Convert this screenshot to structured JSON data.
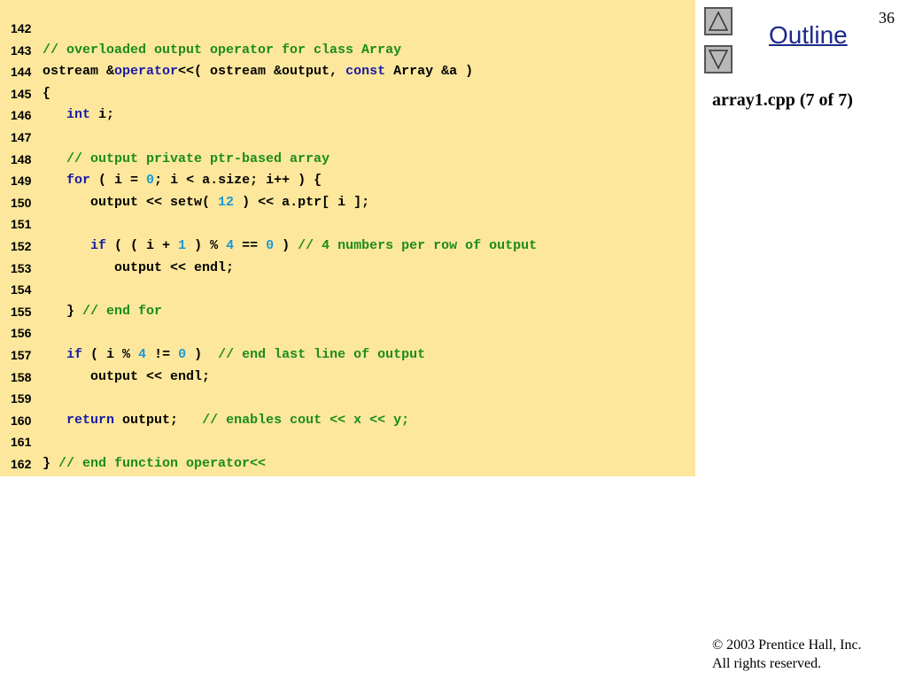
{
  "header": {
    "page_number": "36",
    "outline_label": "Outline",
    "slide_subtitle": "array1.cpp (7 of 7)"
  },
  "footer": {
    "copyright_line1": "© 2003 Prentice Hall, Inc.",
    "copyright_line2": "All rights reserved."
  },
  "nav": {
    "up_icon": "triangle-up-icon",
    "down_icon": "triangle-down-icon"
  },
  "colors": {
    "code_background": "#fce79c",
    "comment": "#1a8c1a",
    "keyword": "#1a1aa6",
    "number": "#1a9ad6",
    "outline_link": "#1b2a8a"
  },
  "code": {
    "lines": [
      {
        "num": "142",
        "tokens": []
      },
      {
        "num": "143",
        "tokens": [
          {
            "t": "cm",
            "v": "// overloaded output operator for class Array"
          }
        ]
      },
      {
        "num": "144",
        "tokens": [
          {
            "t": "",
            "v": "ostream &"
          },
          {
            "t": "kw",
            "v": "operator"
          },
          {
            "t": "",
            "v": "<<( ostream &output, "
          },
          {
            "t": "kw",
            "v": "const"
          },
          {
            "t": "",
            "v": " Array &a )"
          }
        ]
      },
      {
        "num": "145",
        "tokens": [
          {
            "t": "",
            "v": "{"
          }
        ]
      },
      {
        "num": "146",
        "tokens": [
          {
            "t": "",
            "v": "   "
          },
          {
            "t": "kw",
            "v": "int"
          },
          {
            "t": "",
            "v": " i;"
          }
        ]
      },
      {
        "num": "147",
        "tokens": []
      },
      {
        "num": "148",
        "tokens": [
          {
            "t": "",
            "v": "   "
          },
          {
            "t": "cm",
            "v": "// output private ptr-based array"
          }
        ]
      },
      {
        "num": "149",
        "tokens": [
          {
            "t": "",
            "v": "   "
          },
          {
            "t": "kw",
            "v": "for"
          },
          {
            "t": "",
            "v": " ( i = "
          },
          {
            "t": "num",
            "v": "0"
          },
          {
            "t": "",
            "v": "; i < a.size; i++ ) {"
          }
        ]
      },
      {
        "num": "150",
        "tokens": [
          {
            "t": "",
            "v": "      output << setw( "
          },
          {
            "t": "num",
            "v": "12"
          },
          {
            "t": "",
            "v": " ) << a.ptr[ i ];"
          }
        ]
      },
      {
        "num": "151",
        "tokens": []
      },
      {
        "num": "152",
        "tokens": [
          {
            "t": "",
            "v": "      "
          },
          {
            "t": "kw",
            "v": "if"
          },
          {
            "t": "",
            "v": " ( ( i + "
          },
          {
            "t": "num",
            "v": "1"
          },
          {
            "t": "",
            "v": " ) % "
          },
          {
            "t": "num",
            "v": "4"
          },
          {
            "t": "",
            "v": " == "
          },
          {
            "t": "num",
            "v": "0"
          },
          {
            "t": "",
            "v": " ) "
          },
          {
            "t": "cm",
            "v": "// 4 numbers per row of output"
          }
        ]
      },
      {
        "num": "153",
        "tokens": [
          {
            "t": "",
            "v": "         output << endl;"
          }
        ]
      },
      {
        "num": "154",
        "tokens": []
      },
      {
        "num": "155",
        "tokens": [
          {
            "t": "",
            "v": "   } "
          },
          {
            "t": "cm",
            "v": "// end for"
          }
        ]
      },
      {
        "num": "156",
        "tokens": []
      },
      {
        "num": "157",
        "tokens": [
          {
            "t": "",
            "v": "   "
          },
          {
            "t": "kw",
            "v": "if"
          },
          {
            "t": "",
            "v": " ( i % "
          },
          {
            "t": "num",
            "v": "4"
          },
          {
            "t": "",
            "v": " != "
          },
          {
            "t": "num",
            "v": "0"
          },
          {
            "t": "",
            "v": " )  "
          },
          {
            "t": "cm",
            "v": "// end last line of output"
          }
        ]
      },
      {
        "num": "158",
        "tokens": [
          {
            "t": "",
            "v": "      output << endl;"
          }
        ]
      },
      {
        "num": "159",
        "tokens": []
      },
      {
        "num": "160",
        "tokens": [
          {
            "t": "",
            "v": "   "
          },
          {
            "t": "kw",
            "v": "return"
          },
          {
            "t": "",
            "v": " output;   "
          },
          {
            "t": "cm",
            "v": "// enables cout << x << y;"
          }
        ]
      },
      {
        "num": "161",
        "tokens": []
      },
      {
        "num": "162",
        "tokens": [
          {
            "t": "",
            "v": "} "
          },
          {
            "t": "cm",
            "v": "// end function operator<<"
          }
        ]
      }
    ]
  }
}
